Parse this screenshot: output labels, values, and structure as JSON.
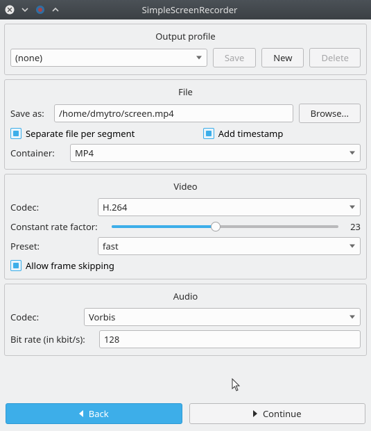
{
  "window": {
    "title": "SimpleScreenRecorder"
  },
  "profile": {
    "title": "Output profile",
    "selected": "(none)",
    "save": "Save",
    "new": "New",
    "delete": "Delete"
  },
  "file": {
    "title": "File",
    "save_as_label": "Save as:",
    "save_as_value": "/home/dmytro/screen.mp4",
    "browse": "Browse...",
    "separate_label": "Separate file per segment",
    "timestamp_label": "Add timestamp",
    "container_label": "Container:",
    "container_value": "MP4"
  },
  "video": {
    "title": "Video",
    "codec_label": "Codec:",
    "codec_value": "H.264",
    "crf_label": "Constant rate factor:",
    "crf_value": "23",
    "preset_label": "Preset:",
    "preset_value": "fast",
    "frameskip_label": "Allow frame skipping"
  },
  "audio": {
    "title": "Audio",
    "codec_label": "Codec:",
    "codec_value": "Vorbis",
    "bitrate_label": "Bit rate (in kbit/s):",
    "bitrate_value": "128"
  },
  "nav": {
    "back": "Back",
    "continue": "Continue"
  }
}
